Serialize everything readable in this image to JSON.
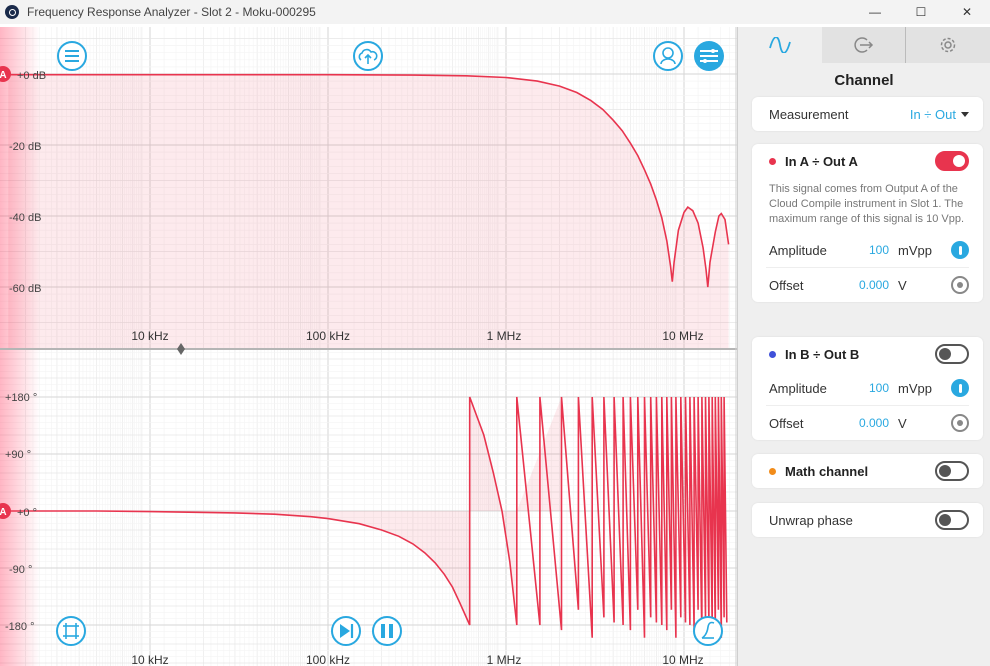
{
  "window": {
    "title": "Frequency Response Analyzer - Slot 2 - Moku-000295",
    "minimize": "—",
    "maximize": "☐",
    "close": "✕"
  },
  "plot": {
    "marker_label": "A",
    "magnitude_ticks": [
      "+0 dB",
      "-20 dB",
      "-40 dB",
      "-60 dB"
    ],
    "phase_ticks": [
      "+180 °",
      "+90 °",
      "+0 °",
      "-90 °",
      "-180 °"
    ],
    "freq_ticks": [
      "10 kHz",
      "100 kHz",
      "1 MHz",
      "10 MHz"
    ],
    "trace_color": "#e8344e",
    "accent": "#29a8e0"
  },
  "panel": {
    "tabs": [
      "waveform-icon",
      "export-icon",
      "gear-icon"
    ],
    "title": "Channel",
    "measurement": {
      "label": "Measurement",
      "value": "In ÷ Out"
    },
    "channel_a": {
      "title": "In A ÷ Out A",
      "color": "#e8344e",
      "enabled": true,
      "description": "This signal comes from Output A of the Cloud Compile instrument in Slot 1. The maximum range of this signal is 10 Vpp.",
      "amplitude_label": "Amplitude",
      "amplitude": "100",
      "amplitude_unit": "mVpp",
      "offset_label": "Offset",
      "offset": "0.000",
      "offset_unit": "V"
    },
    "channel_b": {
      "title": "In B ÷ Out B",
      "color": "#3f51d9",
      "enabled": false,
      "amplitude_label": "Amplitude",
      "amplitude": "100",
      "amplitude_unit": "mVpp",
      "offset_label": "Offset",
      "offset": "0.000",
      "offset_unit": "V"
    },
    "math": {
      "title": "Math channel",
      "color": "#f28c1a",
      "enabled": false
    },
    "unwrap": {
      "title": "Unwrap phase",
      "enabled": false
    }
  }
}
